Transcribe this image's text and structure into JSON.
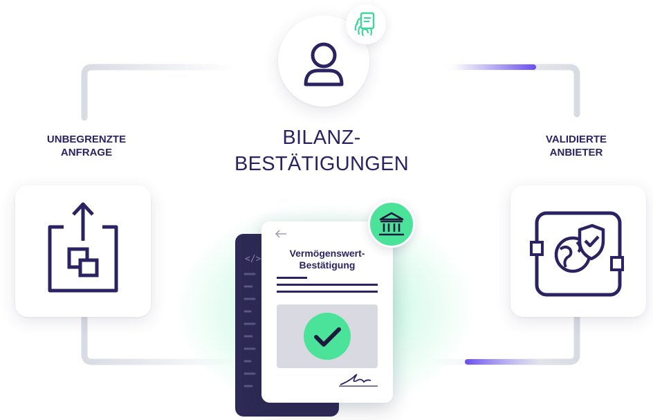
{
  "left_label": {
    "line1": "UNBEGRENZTE",
    "line2": "ANFRAGE"
  },
  "right_label": {
    "line1": "VALIDIERTE",
    "line2": "ANBIETER"
  },
  "center_title": {
    "line1": "BILANZ-",
    "line2": "BESTÄTIGUNGEN"
  },
  "document": {
    "title_line1": "Vermögenswert-",
    "title_line2": "Bestätigung"
  },
  "icons": {
    "user": "user-icon",
    "fingerprint": "fingerprint-document-icon",
    "upload": "upload-copy-icon",
    "validated": "globe-shield-icon",
    "bank": "bank-icon",
    "check": "checkmark-icon",
    "code": "code-icon",
    "signature": "signature-icon"
  },
  "colors": {
    "navy": "#2b2361",
    "green": "#4be39a",
    "purple": "#6a4cf0",
    "connector": "#d9dbe3"
  }
}
